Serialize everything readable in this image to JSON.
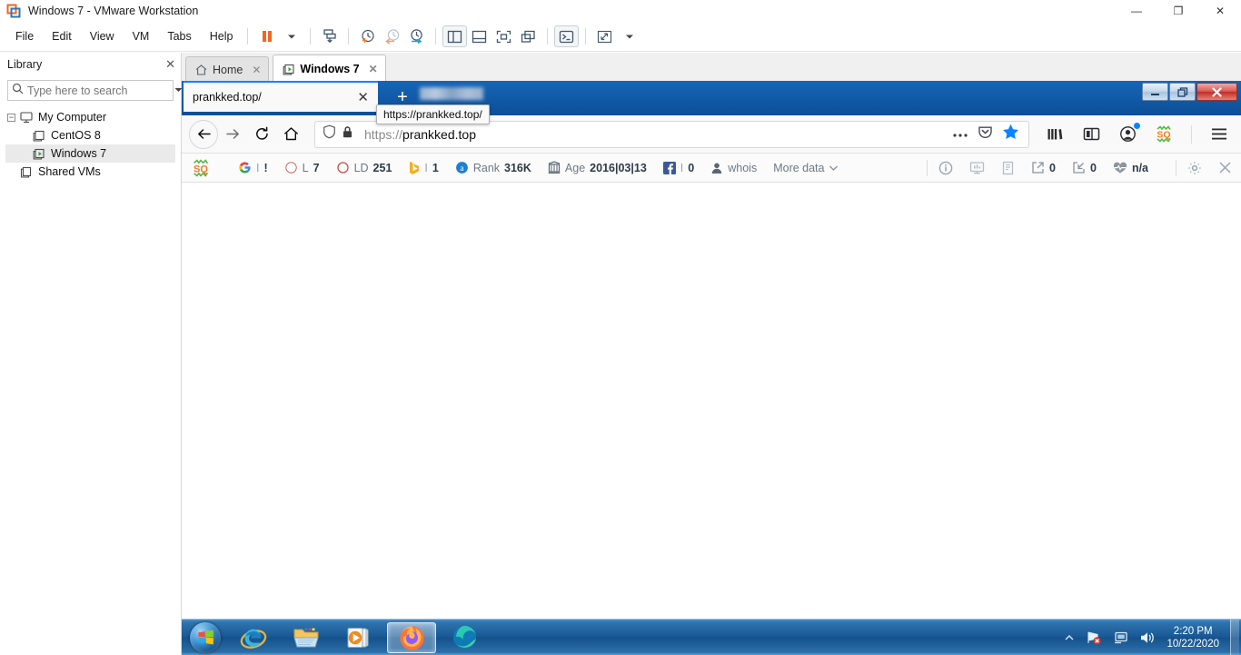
{
  "vmware": {
    "title": "Windows 7 - VMware Workstation",
    "window_buttons": {
      "minimize": "—",
      "maximize": "❐",
      "close": "✕"
    },
    "menu": [
      "File",
      "Edit",
      "View",
      "VM",
      "Tabs",
      "Help"
    ],
    "toolbar_icons": [
      "pause-icon",
      "dropdown-arrow-icon",
      "send-ctrl-alt-del-icon",
      "take-snapshot-icon",
      "revert-snapshot-icon",
      "snapshot-manager-icon",
      "show-library-icon",
      "show-thumbnail-bar-icon",
      "fullscreen-icon",
      "unity-mode-icon",
      "console-view-icon",
      "stretch-guest-icon",
      "view-dropdown-icon"
    ],
    "library": {
      "title": "Library",
      "close_icon": "close-icon",
      "search_placeholder": "Type here to search",
      "search_value": "",
      "search_icon": "search-icon",
      "search_dropdown_icon": "chevron-down-icon",
      "tree": [
        {
          "label": "My Computer",
          "icon": "computer-icon",
          "level": 0,
          "expanded": true,
          "selected": false
        },
        {
          "label": "CentOS 8",
          "icon": "vm-icon",
          "level": 1,
          "expanded": false,
          "selected": false
        },
        {
          "label": "Windows 7",
          "icon": "vm-running-icon",
          "level": 1,
          "expanded": false,
          "selected": true
        },
        {
          "label": "Shared VMs",
          "icon": "shared-vms-icon",
          "level": 0,
          "expanded": false,
          "selected": false
        }
      ]
    },
    "tabs": [
      {
        "label": "Home",
        "icon": "home-icon",
        "active": false,
        "close_icon": "close-icon"
      },
      {
        "label": "Windows 7",
        "icon": "vm-running-icon",
        "active": true,
        "close_icon": "close-icon"
      }
    ]
  },
  "firefox": {
    "window_buttons": {
      "minimize": "—",
      "restore": "❐",
      "close": "✕"
    },
    "tab": {
      "title": "prankked.top/",
      "close_icon": "close-icon"
    },
    "new_tab_icon": "plus-icon",
    "tooltip": "https://prankked.top/",
    "nav": {
      "back_icon": "back-arrow-icon",
      "forward_icon": "forward-arrow-icon",
      "reload_icon": "reload-icon",
      "home_icon": "home-icon"
    },
    "urlbar": {
      "shield_icon": "shield-icon",
      "lock_icon": "padlock-icon",
      "scheme": "https://",
      "host": "prankked.top",
      "page_actions_icon": "ellipsis-icon",
      "pocket_icon": "pocket-icon",
      "bookmark_icon": "star-filled-icon"
    },
    "toolbar_right": {
      "library_icon": "library-icon",
      "sidebar_icon": "sidebar-icon",
      "account_icon": "account-icon",
      "seoquake_icon": "seoquake-icon",
      "menu_icon": "hamburger-menu-icon"
    }
  },
  "seoquake": {
    "logo_icon": "seoquake-icon",
    "metrics": [
      {
        "icon": "google-icon",
        "label": "",
        "sep": "I",
        "value": "!"
      },
      {
        "icon": "google-index-icon",
        "label": "L",
        "sep": "",
        "value": "7"
      },
      {
        "icon": "google-links-icon",
        "label": "LD",
        "sep": "",
        "value": "251"
      },
      {
        "icon": "bing-icon",
        "label": "",
        "sep": "I",
        "value": "1"
      },
      {
        "icon": "alexa-icon",
        "label": "Rank",
        "sep": "",
        "value": "316K"
      },
      {
        "icon": "webarchive-icon",
        "label": "Age",
        "sep": "",
        "value": "2016|03|13"
      },
      {
        "icon": "facebook-icon",
        "label": "",
        "sep": "I",
        "value": "0"
      },
      {
        "icon": "whois-icon",
        "label": "whois",
        "sep": "",
        "value": ""
      }
    ],
    "more_data": "More data",
    "more_data_icon": "chevron-down-icon",
    "tools": [
      {
        "icon": "page-info-icon",
        "value": ""
      },
      {
        "icon": "seo-audit-icon",
        "value": ""
      },
      {
        "icon": "keyword-density-icon",
        "value": ""
      },
      {
        "icon": "external-links-icon",
        "value": "0"
      },
      {
        "icon": "internal-links-icon",
        "value": "0"
      },
      {
        "icon": "page-health-icon",
        "value": "n/a"
      }
    ],
    "settings_icon": "gear-icon",
    "close_icon": "close-icon"
  },
  "taskbar": {
    "start_icon": "windows-start-orb",
    "items": [
      {
        "icon": "internet-explorer-icon",
        "active": false
      },
      {
        "icon": "windows-explorer-icon",
        "active": false
      },
      {
        "icon": "windows-media-player-icon",
        "active": false
      },
      {
        "icon": "firefox-icon",
        "active": true
      },
      {
        "icon": "microsoft-edge-icon",
        "active": false
      }
    ],
    "tray": {
      "show_hidden_icon": "chevron-up-icon",
      "network_icon": "network-error-icon",
      "display_icon": "display-icon",
      "volume_icon": "volume-icon"
    },
    "clock": {
      "time": "2:20 PM",
      "date": "10/22/2020"
    }
  },
  "colors": {
    "vmware_orange": "#f26522",
    "firefox_tab_accent": "#0a84ff",
    "bookmark_star": "#0a84ff",
    "taskbar_blue": "#1a5a97",
    "seoquake_orange": "#f47b20"
  }
}
